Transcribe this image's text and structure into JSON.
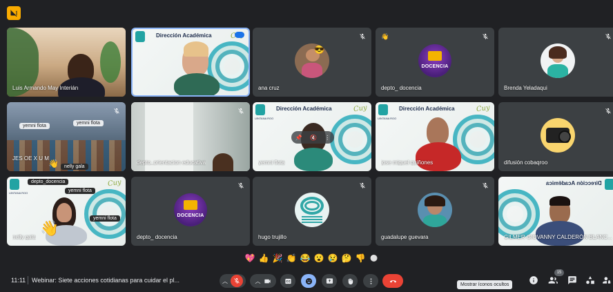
{
  "participants": [
    {
      "name": "Luis Armando May Interián"
    },
    {
      "name": "ana cruz"
    },
    {
      "name": "depto_ docencia"
    },
    {
      "name": "Brenda Yeladaqui"
    },
    {
      "name": "depto_orientacion educativa"
    },
    {
      "name": "yemni flota"
    },
    {
      "name": "jose miguel quiñones"
    },
    {
      "name": "difusión cobaqroo"
    },
    {
      "name": "nelly gala"
    },
    {
      "name": "depto_ docencia"
    },
    {
      "name": "hugo trujillo"
    },
    {
      "name": "guadalupe guevara"
    },
    {
      "name": "GILMER GIOVANNY CALDERÓN BLANC..."
    }
  ],
  "slide": {
    "title": "Dirección Académica",
    "logo_label": "UINTANA ROO"
  },
  "docencia_label": "DOCENCIA",
  "overlay_tags": {
    "t1": "yemni flota",
    "t2": "yemni flota",
    "t3": "nelly gala",
    "t4": "depto_docencia",
    "t5": "yemni flota",
    "t6": "yemni flota"
  },
  "reactions": [
    "💖",
    "👍",
    "🎉",
    "👏",
    "😂",
    "😮",
    "😢",
    "🤔",
    "👎",
    "⚪"
  ],
  "bottom": {
    "time": "11:11",
    "meeting_title": "Webinar: Siete acciones cotidianas para cuidar el pl...",
    "tooltip": "Mostrar íconos ocultos",
    "participants_count": "15"
  },
  "colors": {
    "background": "#202124",
    "tile": "#3c4043",
    "leave_red": "#ea4335",
    "accent_blue": "#8ab4f8",
    "badge_yellow": "#f9ab00"
  }
}
